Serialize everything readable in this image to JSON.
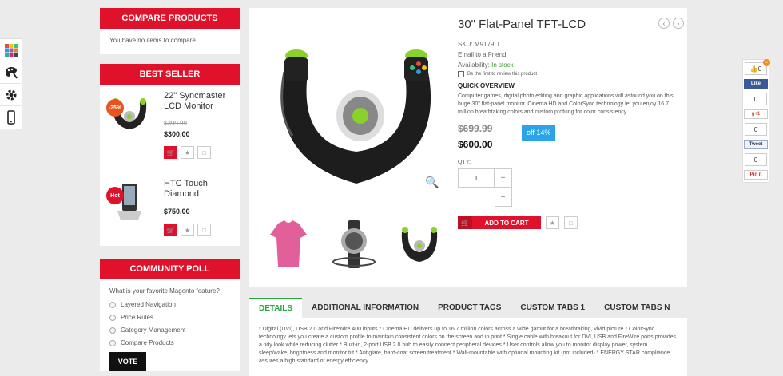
{
  "rail": {
    "icons": [
      "color-palette-icon",
      "paint-palette-icon",
      "gear-icon",
      "mobile-icon"
    ]
  },
  "compare": {
    "title": "COMPARE PRODUCTS",
    "empty_text": "You have no items to compare."
  },
  "best_seller": {
    "title": "BEST SELLER",
    "items": [
      {
        "name": "22\" Syncmaster LCD Monitor",
        "badge": "-25%",
        "old_price": "$399.99",
        "price": "$300.00"
      },
      {
        "name": "HTC Touch Diamond",
        "badge": "Hot",
        "price": "$750.00"
      }
    ]
  },
  "poll": {
    "title": "COMMUNITY POLL",
    "question": "What is your favorite Magento feature?",
    "options": [
      "Layered Navigation",
      "Price Rules",
      "Category Management",
      "Compare Products"
    ],
    "vote_label": "VOTE"
  },
  "product": {
    "title": "30\" Flat-Panel TFT-LCD",
    "sku": "SKU: M9179LL",
    "email_friend": "Email to a Friend",
    "availability_label": "Availability:",
    "availability_value": "In stock",
    "review_text": "Be the first to review this product",
    "quick_overview_title": "QUICK OVERVIEW",
    "quick_overview_text": "Computer games, digital photo editing and graphic applications will astound you on this huge 30\" flat-panel monitor. Cinema HD and ColorSync technology let you enjoy 16.7 million breathtaking colors and custom profiling for color consistency.",
    "old_price": "$699.99",
    "price": "$600.00",
    "discount": "off 14%",
    "qty_label": "QTY:",
    "qty_value": "1",
    "add_to_cart": "ADD TO CART"
  },
  "tabs": {
    "items": [
      "DETAILS",
      "ADDITIONAL INFORMATION",
      "PRODUCT TAGS",
      "CUSTOM TABS 1",
      "CUSTOM TABS N"
    ],
    "active": 0,
    "content": "* Digital (DVI), USB 2.0 and FireWire 400 inputs * Cinema HD delivers up to 16.7 million colors across a wide gamut for a breathtaking, vivid picture * ColorSync technology lets you create a custom profile to maintain consistent colors on the screen and in print * Single cable with breakout for DVI, USB and FireWire ports provides a tidy look while reducing clutter * Built-in, 2-port USB 2.0 hub to easily connect peripheral devices * User controls allow you to monitor display power, system sleep/wake, brightness and monitor tilt * Antiglare, hard-coat screen treatment * Wall-mountable with optional mounting kit (not included) * ENERGY STAR compliance assures a high standard of energy efficiency"
  },
  "social": {
    "like_count": "0",
    "fb_label": "Like",
    "fb_count": "0",
    "gplus_label": "g+1",
    "gplus_count": "0",
    "tweet_label": "Tweet",
    "pin_count": "0",
    "pin_label": "Pin it"
  },
  "colors": {
    "brand_red": "#e0122b",
    "accent_green": "#26a63e",
    "discount_blue": "#2ba3e8"
  }
}
